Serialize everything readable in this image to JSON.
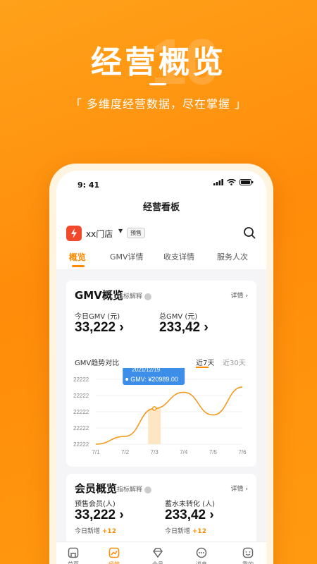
{
  "hero": {
    "bg_number": "10",
    "title": "经营概览",
    "subtitle": "「 多维度经营数据，尽在掌握 」"
  },
  "status": {
    "time": "9: 41"
  },
  "nav": {
    "title": "经营看板"
  },
  "store": {
    "name": "xx门店",
    "tag": "预售"
  },
  "tabs": [
    {
      "label": "概览",
      "active": true
    },
    {
      "label": "GMV详情"
    },
    {
      "label": "收支详情"
    },
    {
      "label": "服务人次"
    }
  ],
  "gmv": {
    "title": "GMV概览",
    "hint": "指标解释",
    "detail": "详情 ›",
    "today_label": "今日GMV (元)",
    "today_value": "33,222 ›",
    "total_label": "总GMV (元)",
    "total_value": "233,42 ›",
    "trend_title": "GMV趋势对比",
    "range_7": "近7天",
    "range_30": "近30天"
  },
  "chart_data": {
    "type": "line",
    "x": [
      "7/1",
      "7/2",
      "7/3",
      "7/4",
      "7/5",
      "7/6"
    ],
    "y_ticks": [
      "22222",
      "22222",
      "22222",
      "22222",
      "22222"
    ],
    "series": [
      {
        "values": [
          0.0,
          0.12,
          0.55,
          0.8,
          0.45,
          0.88
        ]
      }
    ],
    "ylim": [
      0,
      1
    ],
    "highlight": {
      "index": 2,
      "date": "2021/12/19",
      "label": "GMV: ¥20989.00"
    },
    "color": "#f39a1e"
  },
  "member": {
    "title": "会员概览",
    "hint": "指标解释",
    "detail": "详情 ›",
    "presale_label": "预售会员(人)",
    "presale_value": "33,222 ›",
    "presale_sub": "今日新增",
    "presale_inc": "+12",
    "convert_label": "蓄水未转化 (人)",
    "convert_value": "233,42 ›",
    "convert_sub": "今日新增",
    "convert_inc": "+12"
  },
  "tabbar": [
    {
      "label": "首页",
      "icon": "home-icon"
    },
    {
      "label": "经营",
      "icon": "chart-icon",
      "active": true
    },
    {
      "label": "会员",
      "icon": "diamond-icon"
    },
    {
      "label": "消息",
      "icon": "message-icon"
    },
    {
      "label": "我的",
      "icon": "profile-icon"
    }
  ],
  "colors": {
    "accent": "#ff8a00",
    "brand_red": "#f0492b",
    "tooltip": "#3c8ee8"
  }
}
